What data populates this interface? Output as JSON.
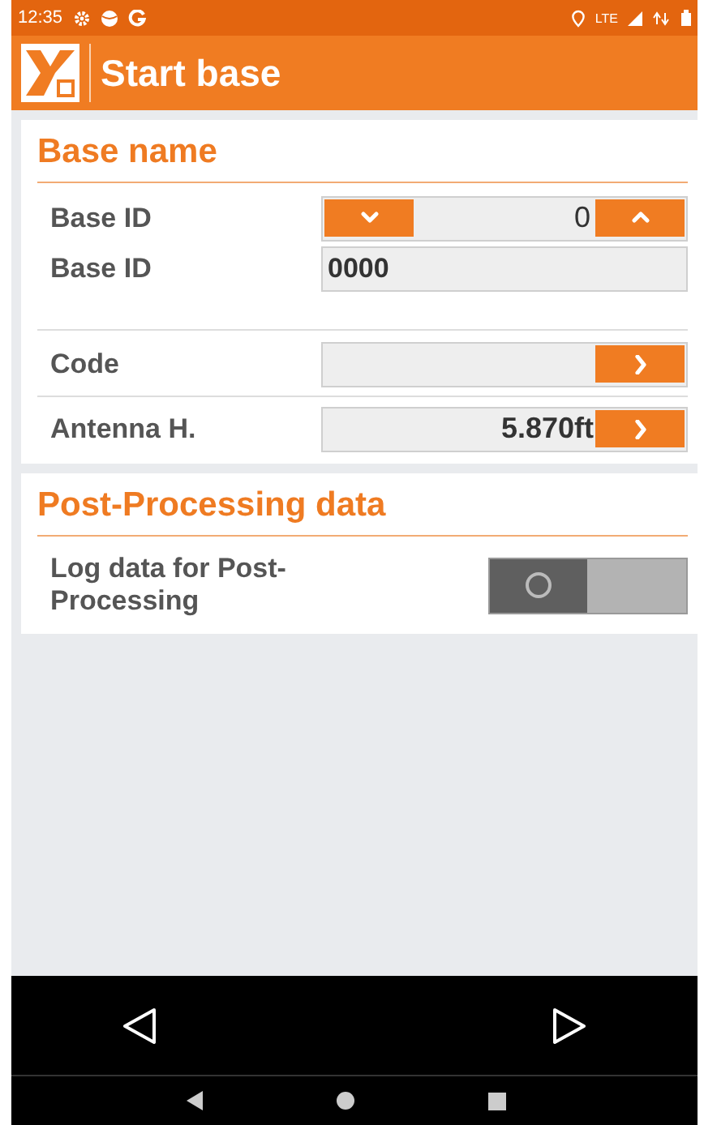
{
  "status_bar": {
    "time": "12:35",
    "network": "LTE"
  },
  "app_bar": {
    "title": "Start base"
  },
  "sections": [
    {
      "title": "Base name",
      "rows": [
        {
          "kind": "spinner",
          "label": "Base ID",
          "value": "0"
        },
        {
          "kind": "readonly",
          "label": "Base ID",
          "value": "0000"
        },
        {
          "kind": "spacer"
        },
        {
          "kind": "picker",
          "label": "Code",
          "value": ""
        },
        {
          "kind": "picker",
          "label": "Antenna H.",
          "value": "5.870ft"
        }
      ]
    },
    {
      "title": "Post-Processing data",
      "rows": [
        {
          "kind": "toggle",
          "label": "Log data for Post-Processing",
          "on": false
        }
      ]
    }
  ]
}
